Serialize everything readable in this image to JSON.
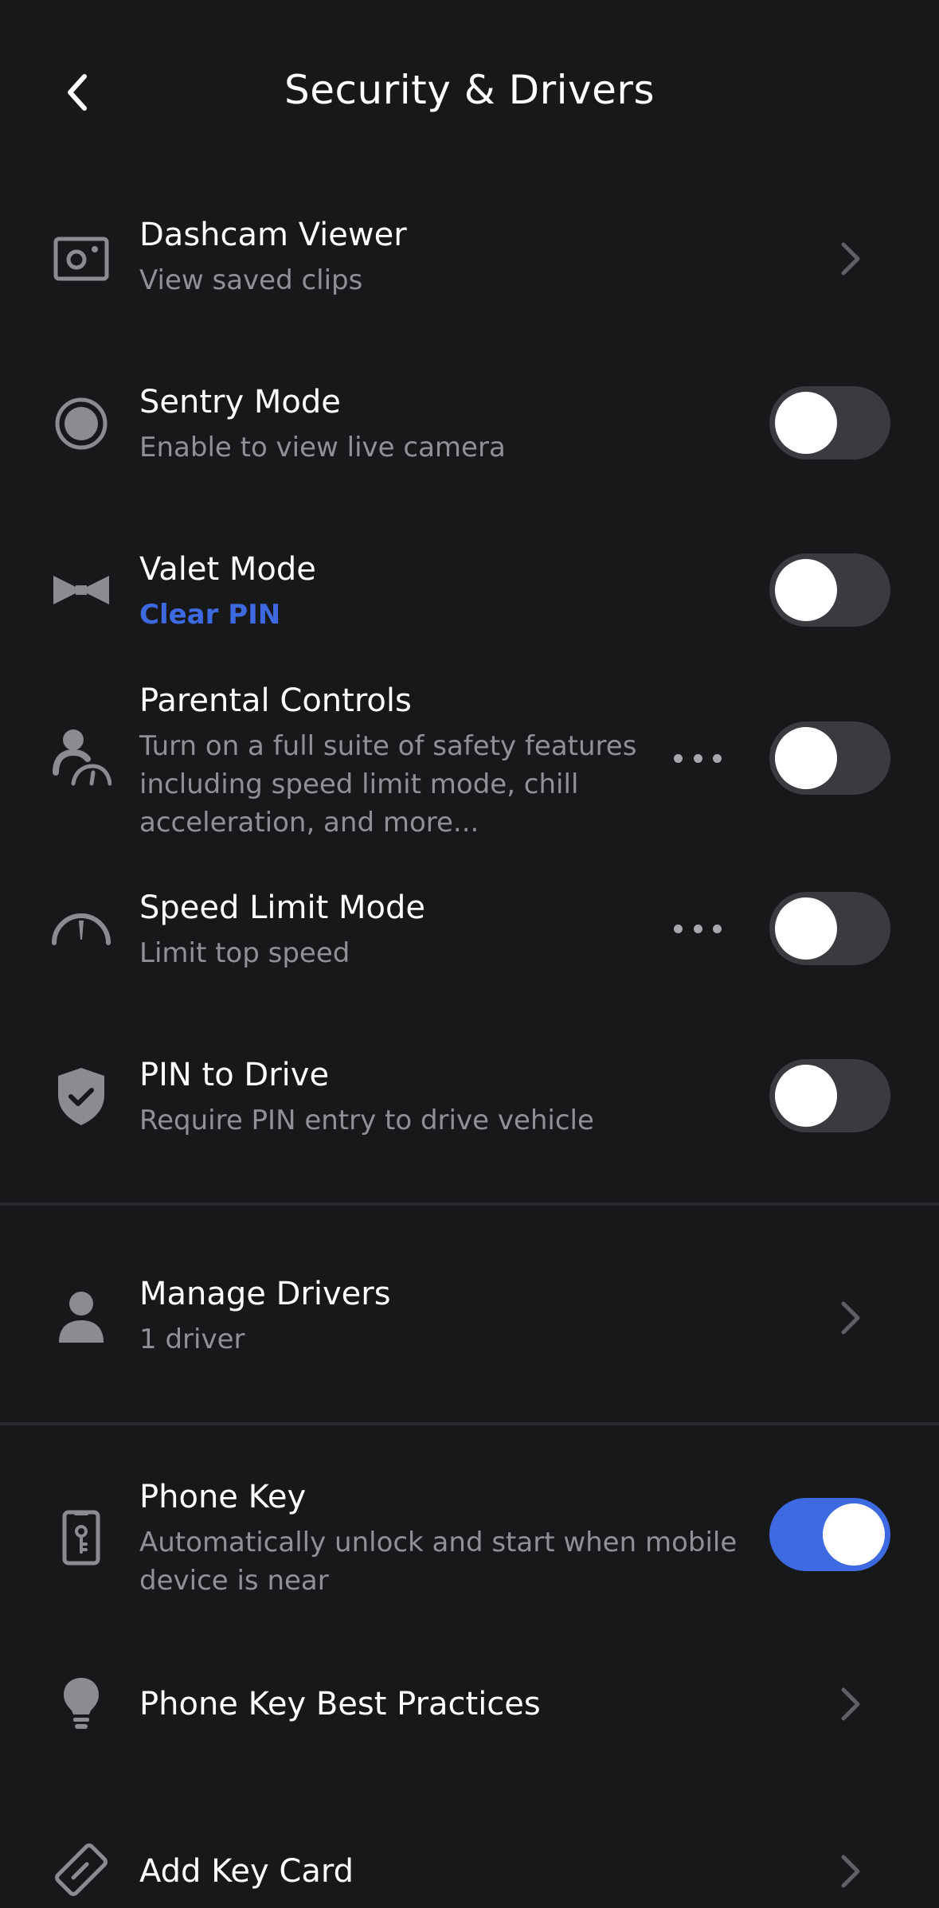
{
  "header": {
    "title": "Security & Drivers",
    "back_icon": "chevron-left-icon"
  },
  "rows": {
    "dashcam": {
      "icon": "dashcam-icon",
      "title": "Dashcam Viewer",
      "subtitle": "View saved clips",
      "control": "chevron"
    },
    "sentry": {
      "icon": "sentry-icon",
      "title": "Sentry Mode",
      "subtitle": "Enable to view live camera",
      "control": "toggle",
      "enabled": false
    },
    "valet": {
      "icon": "bowtie-icon",
      "title": "Valet Mode",
      "subtitle": "Clear PIN",
      "control": "toggle",
      "enabled": false
    },
    "parental": {
      "icon": "parental-icon",
      "title": "Parental Controls",
      "subtitle_lines": [
        "Turn on a full suite of safety features",
        "including speed limit mode, chill",
        "acceleration, and more..."
      ],
      "control": "toggle",
      "enabled": false,
      "more_icon": "more-dots-icon"
    },
    "speed_limit": {
      "icon": "speedometer-icon",
      "title": "Speed Limit Mode",
      "subtitle": "Limit top speed",
      "control": "toggle",
      "enabled": false,
      "more_icon": "more-dots-icon"
    },
    "pin_drive": {
      "icon": "shield-check-icon",
      "title": "PIN to Drive",
      "subtitle": "Require PIN entry to drive vehicle",
      "control": "toggle",
      "enabled": false
    },
    "drivers": {
      "icon": "person-icon",
      "title": "Manage Drivers",
      "subtitle": "1 driver",
      "control": "chevron"
    },
    "phone_key": {
      "icon": "phone-key-icon",
      "title": "Phone Key",
      "subtitle_lines": [
        "Automatically unlock and start when mobile",
        "device is near"
      ],
      "control": "toggle",
      "enabled": true
    },
    "best_practices": {
      "icon": "lightbulb-icon",
      "title": "Phone Key Best Practices",
      "control": "chevron"
    },
    "key_card": {
      "icon": "key-card-icon",
      "title": "Add Key Card",
      "control": "chevron"
    }
  },
  "colors": {
    "background": "#17181a",
    "accent": "#3e6ae1",
    "subtitle": "#8f9196",
    "toggle_off": "#3a3b3f",
    "icon": "#8a8c91"
  }
}
